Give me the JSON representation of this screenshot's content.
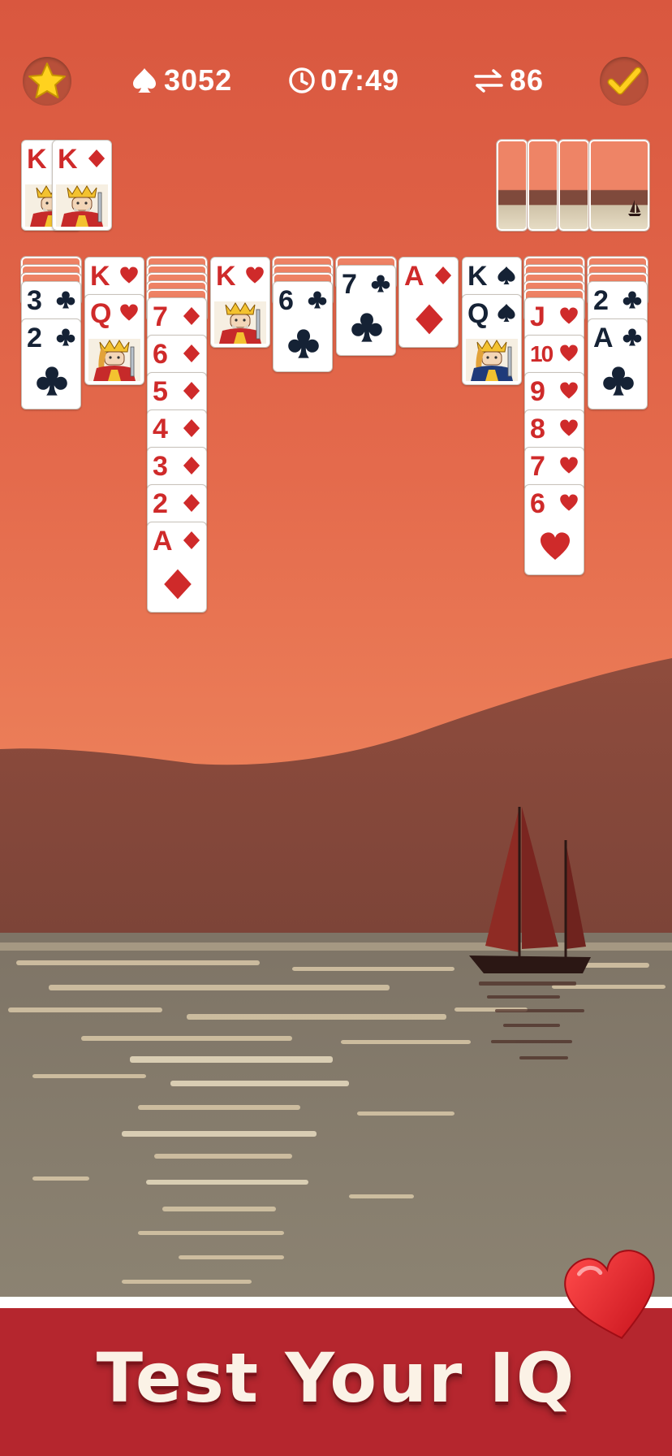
{
  "hud": {
    "score": "3052",
    "time": "07:49",
    "moves": "86",
    "icons": [
      "star-icon",
      "spade-icon",
      "clock-icon",
      "swap-arrows-icon",
      "check-icon"
    ]
  },
  "foundation": [
    {
      "rank": "K",
      "suit": "diamond"
    },
    {
      "rank": "K",
      "suit": "diamond"
    }
  ],
  "stock": {
    "cards_visible": 4
  },
  "tableau": [
    {
      "hidden": 3,
      "cards": [
        {
          "rank": "3",
          "suit": "club"
        },
        {
          "rank": "2",
          "suit": "club"
        }
      ]
    },
    {
      "hidden": 0,
      "cards": [
        {
          "rank": "K",
          "suit": "heart"
        },
        {
          "rank": "Q",
          "suit": "heart"
        }
      ]
    },
    {
      "hidden": 5,
      "cards": [
        {
          "rank": "7",
          "suit": "diamond"
        },
        {
          "rank": "6",
          "suit": "diamond"
        },
        {
          "rank": "5",
          "suit": "diamond"
        },
        {
          "rank": "4",
          "suit": "diamond"
        },
        {
          "rank": "3",
          "suit": "diamond"
        },
        {
          "rank": "2",
          "suit": "diamond"
        },
        {
          "rank": "A",
          "suit": "diamond"
        }
      ]
    },
    {
      "hidden": 0,
      "cards": [
        {
          "rank": "K",
          "suit": "heart"
        }
      ]
    },
    {
      "hidden": 3,
      "cards": [
        {
          "rank": "6",
          "suit": "club"
        }
      ]
    },
    {
      "hidden": 1,
      "cards": [
        {
          "rank": "7",
          "suit": "club"
        }
      ]
    },
    {
      "hidden": 0,
      "cards": [
        {
          "rank": "A",
          "suit": "diamond"
        }
      ]
    },
    {
      "hidden": 0,
      "cards": [
        {
          "rank": "K",
          "suit": "spade"
        },
        {
          "rank": "Q",
          "suit": "spade"
        }
      ]
    },
    {
      "hidden": 5,
      "cards": [
        {
          "rank": "J",
          "suit": "heart"
        },
        {
          "rank": "10",
          "suit": "heart"
        },
        {
          "rank": "9",
          "suit": "heart"
        },
        {
          "rank": "8",
          "suit": "heart"
        },
        {
          "rank": "7",
          "suit": "heart"
        },
        {
          "rank": "6",
          "suit": "heart"
        }
      ]
    },
    {
      "hidden": 3,
      "cards": [
        {
          "rank": "2",
          "suit": "club"
        },
        {
          "rank": "A",
          "suit": "club"
        }
      ]
    }
  ],
  "banner": {
    "text": "Test Your IQ"
  },
  "colors": {
    "sky": "#e0654a",
    "hills": "#8a4a3c",
    "sea": "#8f8473",
    "banner": "#b5262e",
    "card_red": "#cf2a2a",
    "card_black": "#152235"
  }
}
